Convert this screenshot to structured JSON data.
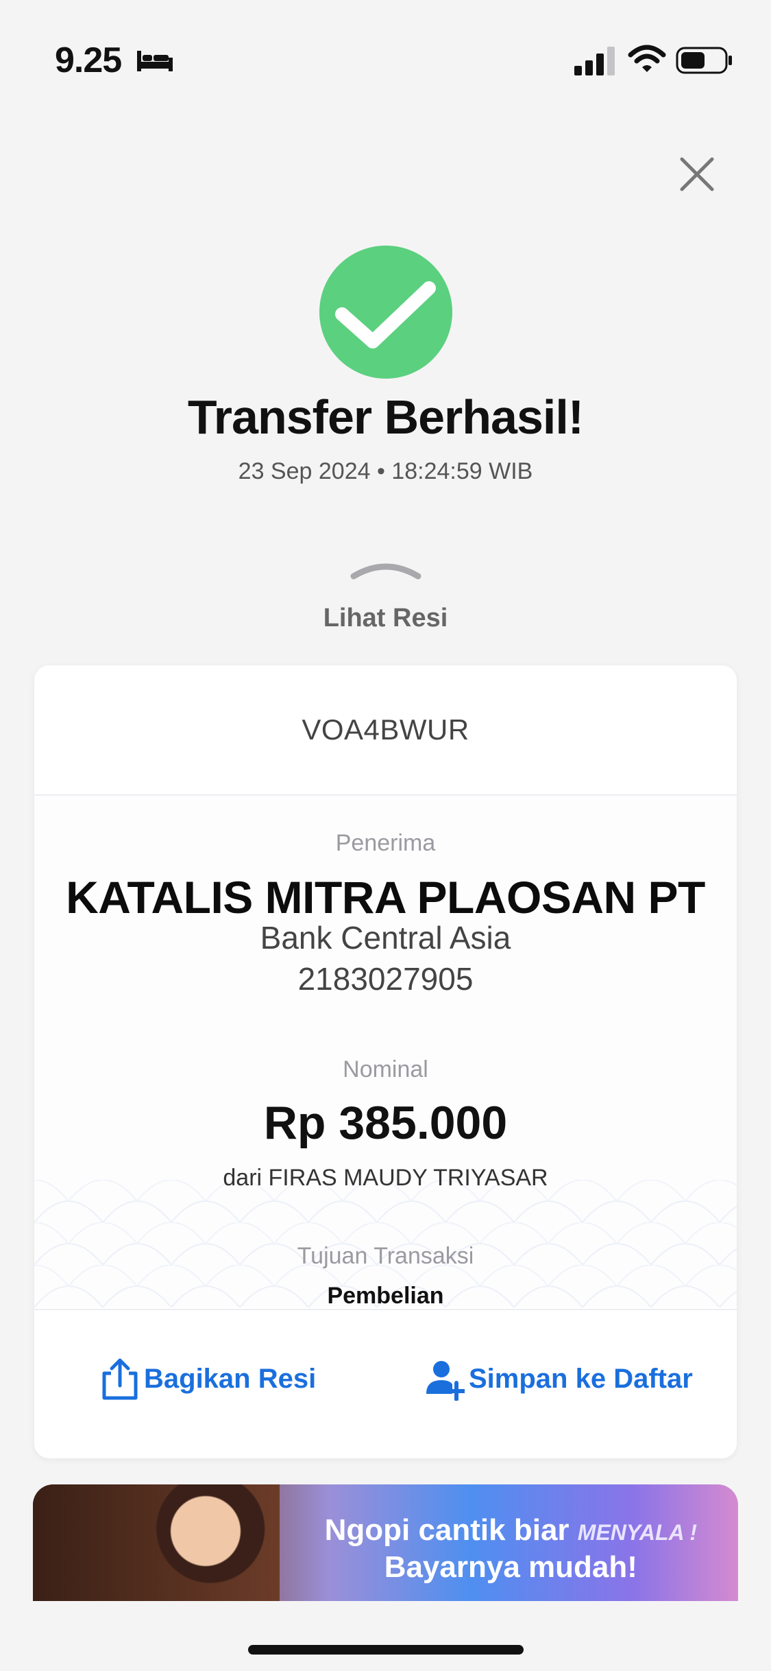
{
  "status_bar": {
    "time": "9.25",
    "icons": [
      "bed-icon",
      "signal-icon",
      "wifi-icon",
      "battery-icon"
    ]
  },
  "header": {
    "close_icon": "close-icon"
  },
  "result": {
    "icon": "check-circle-icon",
    "title": "Transfer Berhasil!",
    "datetime": "23 Sep 2024 • 18:24:59 WIB",
    "toggle_label": "Lihat Resi"
  },
  "receipt": {
    "reference": "VOA4BWUR",
    "recipient_label": "Penerima",
    "recipient_name": "KATALIS MITRA PLAOSAN PT",
    "bank_name": "Bank Central Asia",
    "account_number": "2183027905",
    "amount_label": "Nominal",
    "amount": "Rp 385.000",
    "sender": "dari FIRAS MAUDY TRIYASAR",
    "purpose_label": "Tujuan Transaksi",
    "purpose": "Pembelian"
  },
  "actions": {
    "share_label": "Bagikan Resi",
    "save_label": "Simpan ke Daftar"
  },
  "promo": {
    "line1": "Ngopi cantik biar",
    "line1_highlight": "MENYALA !",
    "line2": "Bayarnya mudah!"
  },
  "colors": {
    "accent": "#1a6fdd",
    "success": "#5bd07f",
    "background": "#f4f4f5"
  }
}
